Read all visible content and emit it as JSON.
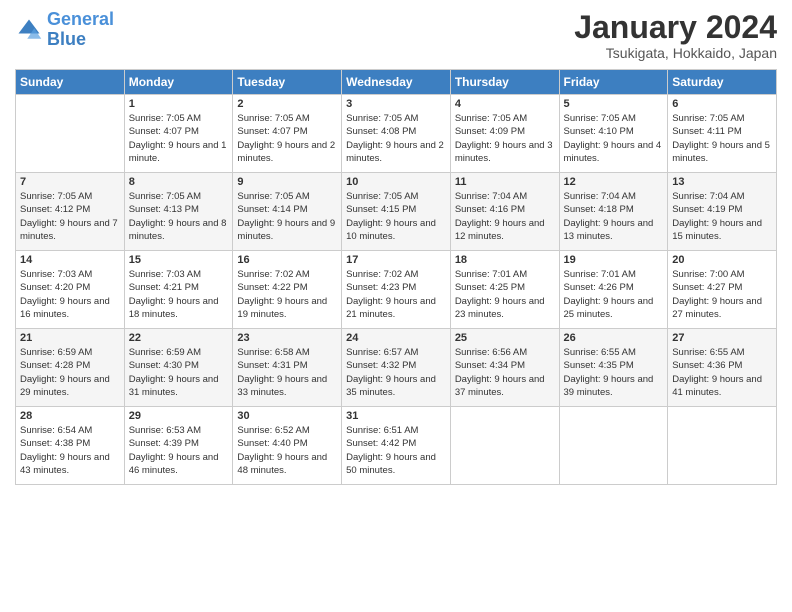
{
  "header": {
    "logo_line1": "General",
    "logo_line2": "Blue",
    "month": "January 2024",
    "location": "Tsukigata, Hokkaido, Japan"
  },
  "columns": [
    "Sunday",
    "Monday",
    "Tuesday",
    "Wednesday",
    "Thursday",
    "Friday",
    "Saturday"
  ],
  "weeks": [
    [
      {
        "day": "",
        "sunrise": "",
        "sunset": "",
        "daylight": ""
      },
      {
        "day": "1",
        "sunrise": "Sunrise: 7:05 AM",
        "sunset": "Sunset: 4:07 PM",
        "daylight": "Daylight: 9 hours and 1 minute."
      },
      {
        "day": "2",
        "sunrise": "Sunrise: 7:05 AM",
        "sunset": "Sunset: 4:07 PM",
        "daylight": "Daylight: 9 hours and 2 minutes."
      },
      {
        "day": "3",
        "sunrise": "Sunrise: 7:05 AM",
        "sunset": "Sunset: 4:08 PM",
        "daylight": "Daylight: 9 hours and 2 minutes."
      },
      {
        "day": "4",
        "sunrise": "Sunrise: 7:05 AM",
        "sunset": "Sunset: 4:09 PM",
        "daylight": "Daylight: 9 hours and 3 minutes."
      },
      {
        "day": "5",
        "sunrise": "Sunrise: 7:05 AM",
        "sunset": "Sunset: 4:10 PM",
        "daylight": "Daylight: 9 hours and 4 minutes."
      },
      {
        "day": "6",
        "sunrise": "Sunrise: 7:05 AM",
        "sunset": "Sunset: 4:11 PM",
        "daylight": "Daylight: 9 hours and 5 minutes."
      }
    ],
    [
      {
        "day": "7",
        "sunrise": "Sunrise: 7:05 AM",
        "sunset": "Sunset: 4:12 PM",
        "daylight": "Daylight: 9 hours and 7 minutes."
      },
      {
        "day": "8",
        "sunrise": "Sunrise: 7:05 AM",
        "sunset": "Sunset: 4:13 PM",
        "daylight": "Daylight: 9 hours and 8 minutes."
      },
      {
        "day": "9",
        "sunrise": "Sunrise: 7:05 AM",
        "sunset": "Sunset: 4:14 PM",
        "daylight": "Daylight: 9 hours and 9 minutes."
      },
      {
        "day": "10",
        "sunrise": "Sunrise: 7:05 AM",
        "sunset": "Sunset: 4:15 PM",
        "daylight": "Daylight: 9 hours and 10 minutes."
      },
      {
        "day": "11",
        "sunrise": "Sunrise: 7:04 AM",
        "sunset": "Sunset: 4:16 PM",
        "daylight": "Daylight: 9 hours and 12 minutes."
      },
      {
        "day": "12",
        "sunrise": "Sunrise: 7:04 AM",
        "sunset": "Sunset: 4:18 PM",
        "daylight": "Daylight: 9 hours and 13 minutes."
      },
      {
        "day": "13",
        "sunrise": "Sunrise: 7:04 AM",
        "sunset": "Sunset: 4:19 PM",
        "daylight": "Daylight: 9 hours and 15 minutes."
      }
    ],
    [
      {
        "day": "14",
        "sunrise": "Sunrise: 7:03 AM",
        "sunset": "Sunset: 4:20 PM",
        "daylight": "Daylight: 9 hours and 16 minutes."
      },
      {
        "day": "15",
        "sunrise": "Sunrise: 7:03 AM",
        "sunset": "Sunset: 4:21 PM",
        "daylight": "Daylight: 9 hours and 18 minutes."
      },
      {
        "day": "16",
        "sunrise": "Sunrise: 7:02 AM",
        "sunset": "Sunset: 4:22 PM",
        "daylight": "Daylight: 9 hours and 19 minutes."
      },
      {
        "day": "17",
        "sunrise": "Sunrise: 7:02 AM",
        "sunset": "Sunset: 4:23 PM",
        "daylight": "Daylight: 9 hours and 21 minutes."
      },
      {
        "day": "18",
        "sunrise": "Sunrise: 7:01 AM",
        "sunset": "Sunset: 4:25 PM",
        "daylight": "Daylight: 9 hours and 23 minutes."
      },
      {
        "day": "19",
        "sunrise": "Sunrise: 7:01 AM",
        "sunset": "Sunset: 4:26 PM",
        "daylight": "Daylight: 9 hours and 25 minutes."
      },
      {
        "day": "20",
        "sunrise": "Sunrise: 7:00 AM",
        "sunset": "Sunset: 4:27 PM",
        "daylight": "Daylight: 9 hours and 27 minutes."
      }
    ],
    [
      {
        "day": "21",
        "sunrise": "Sunrise: 6:59 AM",
        "sunset": "Sunset: 4:28 PM",
        "daylight": "Daylight: 9 hours and 29 minutes."
      },
      {
        "day": "22",
        "sunrise": "Sunrise: 6:59 AM",
        "sunset": "Sunset: 4:30 PM",
        "daylight": "Daylight: 9 hours and 31 minutes."
      },
      {
        "day": "23",
        "sunrise": "Sunrise: 6:58 AM",
        "sunset": "Sunset: 4:31 PM",
        "daylight": "Daylight: 9 hours and 33 minutes."
      },
      {
        "day": "24",
        "sunrise": "Sunrise: 6:57 AM",
        "sunset": "Sunset: 4:32 PM",
        "daylight": "Daylight: 9 hours and 35 minutes."
      },
      {
        "day": "25",
        "sunrise": "Sunrise: 6:56 AM",
        "sunset": "Sunset: 4:34 PM",
        "daylight": "Daylight: 9 hours and 37 minutes."
      },
      {
        "day": "26",
        "sunrise": "Sunrise: 6:55 AM",
        "sunset": "Sunset: 4:35 PM",
        "daylight": "Daylight: 9 hours and 39 minutes."
      },
      {
        "day": "27",
        "sunrise": "Sunrise: 6:55 AM",
        "sunset": "Sunset: 4:36 PM",
        "daylight": "Daylight: 9 hours and 41 minutes."
      }
    ],
    [
      {
        "day": "28",
        "sunrise": "Sunrise: 6:54 AM",
        "sunset": "Sunset: 4:38 PM",
        "daylight": "Daylight: 9 hours and 43 minutes."
      },
      {
        "day": "29",
        "sunrise": "Sunrise: 6:53 AM",
        "sunset": "Sunset: 4:39 PM",
        "daylight": "Daylight: 9 hours and 46 minutes."
      },
      {
        "day": "30",
        "sunrise": "Sunrise: 6:52 AM",
        "sunset": "Sunset: 4:40 PM",
        "daylight": "Daylight: 9 hours and 48 minutes."
      },
      {
        "day": "31",
        "sunrise": "Sunrise: 6:51 AM",
        "sunset": "Sunset: 4:42 PM",
        "daylight": "Daylight: 9 hours and 50 minutes."
      },
      {
        "day": "",
        "sunrise": "",
        "sunset": "",
        "daylight": ""
      },
      {
        "day": "",
        "sunrise": "",
        "sunset": "",
        "daylight": ""
      },
      {
        "day": "",
        "sunrise": "",
        "sunset": "",
        "daylight": ""
      }
    ]
  ]
}
